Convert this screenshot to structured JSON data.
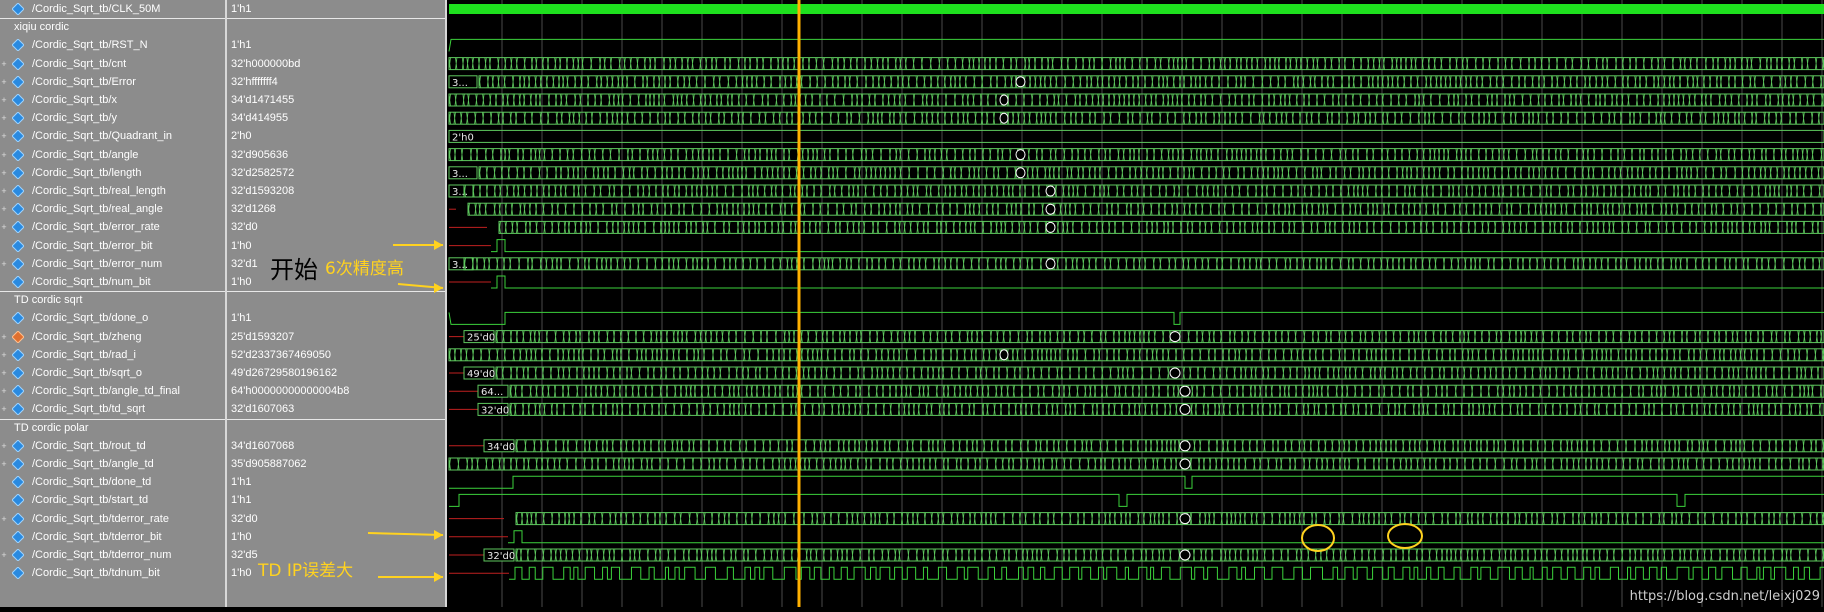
{
  "colors": {
    "panel_bg": "#8c8c8c",
    "wave_bg": "#000000",
    "bus": "#5ec85e",
    "bit": "#3cd23c",
    "cursor": "#ffb000",
    "annotation": "#ffd21f",
    "grid": "#4a4a4a"
  },
  "rows": [
    {
      "kind": "signal",
      "name": "/Cordic_Sqrt_tb/CLK_50M",
      "value": "1'h1",
      "wave": "clock",
      "expand": false
    },
    {
      "kind": "group",
      "label": "xiqiu cordic"
    },
    {
      "kind": "signal",
      "name": "/Cordic_Sqrt_tb/RST_N",
      "value": "1'h1",
      "wave": "bit_high",
      "expand": false
    },
    {
      "kind": "signal",
      "name": "/Cordic_Sqrt_tb/cnt",
      "value": "32'h000000bd",
      "wave": "bus_dense",
      "expand": true
    },
    {
      "kind": "signal",
      "name": "/Cordic_Sqrt_tb/Error",
      "value": "32'hfffffff4",
      "wave": "bus_dense",
      "expand": true,
      "init_label": "3...",
      "gap": [
        1016,
        1025
      ]
    },
    {
      "kind": "signal",
      "name": "/Cordic_Sqrt_tb/x",
      "value": "34'd1471455",
      "wave": "bus_dense",
      "expand": true,
      "gap": [
        1000,
        1008
      ]
    },
    {
      "kind": "signal",
      "name": "/Cordic_Sqrt_tb/y",
      "value": "34'd414955",
      "wave": "bus_dense",
      "expand": true,
      "gap": [
        1000,
        1008
      ]
    },
    {
      "kind": "signal",
      "name": "/Cordic_Sqrt_tb/Quadrant_in",
      "value": "2'h0",
      "wave": "bus_const",
      "expand": true,
      "init_label": "2'h0"
    },
    {
      "kind": "signal",
      "name": "/Cordic_Sqrt_tb/angle",
      "value": "32'd905636",
      "wave": "bus_dense",
      "expand": true,
      "gap": [
        1016,
        1025
      ]
    },
    {
      "kind": "signal",
      "name": "/Cordic_Sqrt_tb/length",
      "value": "32'd2582572",
      "wave": "bus_dense",
      "expand": true,
      "init_label": "3...",
      "gap": [
        1016,
        1025
      ]
    },
    {
      "kind": "signal",
      "name": "/Cordic_Sqrt_tb/real_length",
      "value": "32'd1593208",
      "wave": "bus_late",
      "expand": true,
      "init_label": "3...",
      "start": 462,
      "gap": [
        1046,
        1055
      ]
    },
    {
      "kind": "signal",
      "name": "/Cordic_Sqrt_tb/real_angle",
      "value": "32'd1268",
      "wave": "bus_late",
      "expand": true,
      "start": 466,
      "gap": [
        1046,
        1055
      ]
    },
    {
      "kind": "signal",
      "name": "/Cordic_Sqrt_tb/error_rate",
      "value": "32'd0",
      "wave": "bus_late",
      "expand": true,
      "start": 497,
      "gap": [
        1046,
        1055
      ]
    },
    {
      "kind": "signal",
      "name": "/Cordic_Sqrt_tb/error_bit",
      "value": "1'h0",
      "wave": "bit_pulse",
      "expand": false,
      "pulse": [
        497,
        505
      ]
    },
    {
      "kind": "signal",
      "name": "/Cordic_Sqrt_tb/error_num",
      "value": "32'd1",
      "wave": "bus_late",
      "expand": true,
      "init_label": "3...",
      "start": 462,
      "gap": [
        1046,
        1055
      ]
    },
    {
      "kind": "signal",
      "name": "/Cordic_Sqrt_tb/num_bit",
      "value": "1'h0",
      "wave": "bit_pulse",
      "expand": false,
      "pulse": [
        497,
        505
      ]
    },
    {
      "kind": "group",
      "label": "TD cordic sqrt"
    },
    {
      "kind": "signal",
      "name": "/Cordic_Sqrt_tb/done_o",
      "value": "1'h1",
      "wave": "bit_done",
      "expand": false
    },
    {
      "kind": "signal",
      "name": "/Cordic_Sqrt_tb/zheng",
      "value": "25'd1593207",
      "wave": "bus_late",
      "expand": true,
      "init_label": "25'd0",
      "start": 494,
      "gap": [
        1170,
        1180
      ],
      "icon": "diamond-orange-icon"
    },
    {
      "kind": "signal",
      "name": "/Cordic_Sqrt_tb/rad_i",
      "value": "52'd2337367469050",
      "wave": "bus_dense",
      "expand": true,
      "gap": [
        1000,
        1008
      ]
    },
    {
      "kind": "signal",
      "name": "/Cordic_Sqrt_tb/sqrt_o",
      "value": "49'd26729580196162",
      "wave": "bus_late",
      "expand": true,
      "init_label": "49'd0",
      "start": 494,
      "gap": [
        1170,
        1180
      ]
    },
    {
      "kind": "signal",
      "name": "/Cordic_Sqrt_tb/angle_td_final",
      "value": "64'h00000000000004b8",
      "wave": "bus_late",
      "expand": true,
      "init_label": "64...",
      "start": 508,
      "gap": [
        1180,
        1190
      ]
    },
    {
      "kind": "signal",
      "name": "/Cordic_Sqrt_tb/td_sqrt",
      "value": "32'd1607063",
      "wave": "bus_late",
      "expand": true,
      "init_label": "32'd0",
      "start": 508,
      "gap": [
        1180,
        1190
      ]
    },
    {
      "kind": "group",
      "label": "TD cordic polar"
    },
    {
      "kind": "signal",
      "name": "/Cordic_Sqrt_tb/rout_td",
      "value": "34'd1607068",
      "wave": "bus_late",
      "expand": true,
      "init_label": "34'd0",
      "start": 514,
      "gap": [
        1180,
        1190
      ]
    },
    {
      "kind": "signal",
      "name": "/Cordic_Sqrt_tb/angle_td",
      "value": "35'd905887062",
      "wave": "bus_dense",
      "expand": true,
      "gap": [
        1180,
        1190
      ]
    },
    {
      "kind": "signal",
      "name": "/Cordic_Sqrt_tb/done_td",
      "value": "1'h1",
      "wave": "bit_done2",
      "expand": false
    },
    {
      "kind": "signal",
      "name": "/Cordic_Sqrt_tb/start_td",
      "value": "1'h1",
      "wave": "bit_start",
      "expand": false
    },
    {
      "kind": "signal",
      "name": "/Cordic_Sqrt_tb/tderror_rate",
      "value": "32'd0",
      "wave": "bus_late",
      "expand": true,
      "start": 514,
      "gap": [
        1180,
        1190
      ]
    },
    {
      "kind": "signal",
      "name": "/Cordic_Sqrt_tb/tderror_bit",
      "value": "1'h0",
      "wave": "bit_pulse",
      "expand": false,
      "pulse": [
        514,
        522
      ]
    },
    {
      "kind": "signal",
      "name": "/Cordic_Sqrt_tb/tderror_num",
      "value": "32'd5",
      "wave": "bus_late",
      "expand": true,
      "init_label": "32'd0",
      "start": 514,
      "gap": [
        1180,
        1190
      ]
    },
    {
      "kind": "signal",
      "name": "/Cordic_Sqrt_tb/tdnum_bit",
      "value": "1'h0",
      "wave": "bit_dense",
      "expand": false
    }
  ],
  "annotations": {
    "note1": "6次精度高",
    "note2": "TD IP误差大",
    "scribble": "开始"
  },
  "watermark": "https://blog.csdn.net/leixj029"
}
